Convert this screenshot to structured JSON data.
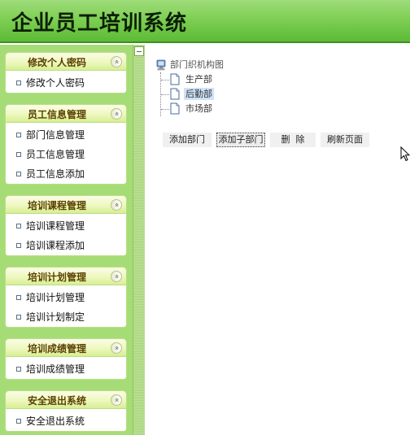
{
  "app": {
    "title": "企业员工培训系统"
  },
  "sidebar": {
    "panels": [
      {
        "title": "修改个人密码",
        "items": [
          "修改个人密码"
        ]
      },
      {
        "title": "员工信息管理",
        "items": [
          "部门信息管理",
          "员工信息管理",
          "员工信息添加"
        ]
      },
      {
        "title": "培训课程管理",
        "items": [
          "培训课程管理",
          "培训课程添加"
        ]
      },
      {
        "title": "培训计划管理",
        "items": [
          "培训计划管理",
          "培训计划制定"
        ]
      },
      {
        "title": "培训成绩管理",
        "items": [
          "培训成绩管理"
        ]
      },
      {
        "title": "安全退出系统",
        "items": [
          "安全退出系统"
        ]
      }
    ],
    "collapse_glyph": "«"
  },
  "tree": {
    "root_label": "部门织机构图",
    "nodes": [
      "生产部",
      "后勤部",
      "市场部"
    ],
    "selected": "后勤部"
  },
  "actions": {
    "add_dept": "添加部门",
    "add_sub_dept": "添加子部门",
    "delete": "删  除",
    "refresh": "刷新页面"
  },
  "colors": {
    "header_green": "#7fcf55",
    "sidebar_green": "#a6dc76",
    "panel_title_text": "#5b4000",
    "selected_node_bg": "#cfe3f8"
  },
  "icons": {
    "root": "computer-icon",
    "node": "document-icon",
    "menu_item": "bullet-square-icon",
    "panel_toggle": "collapse-double-chevron-icon"
  }
}
